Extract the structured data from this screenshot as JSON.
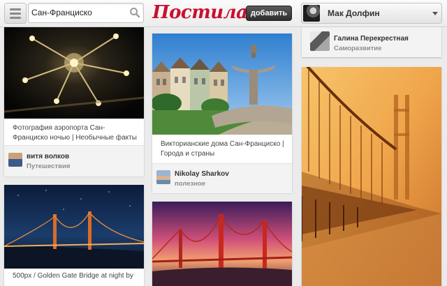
{
  "header": {
    "search_value": "Сан-Франциско",
    "logo": "Постила",
    "add_label": "добавить",
    "user_name": "Мак Долфин"
  },
  "column1": {
    "pin1": {
      "caption": "Фотография аэропорта Сан-Франциско ночью | Необычные факты",
      "user_name": "витя волков",
      "category": "Путешествия"
    },
    "pin2": {
      "caption": "500px / Golden Gate Bridge at night by"
    }
  },
  "column2": {
    "pin1": {
      "caption": "Викторианские дома Сан-Франциско | Города и страны",
      "user_name": "Nikolay Sharkov",
      "category": "полезное"
    }
  },
  "column3": {
    "pin0": {
      "user_name": "Галина Перекрестная",
      "category": "Саморазвитие"
    }
  },
  "colors": {
    "brand": "#c8102e",
    "background": "#ebebeb"
  }
}
